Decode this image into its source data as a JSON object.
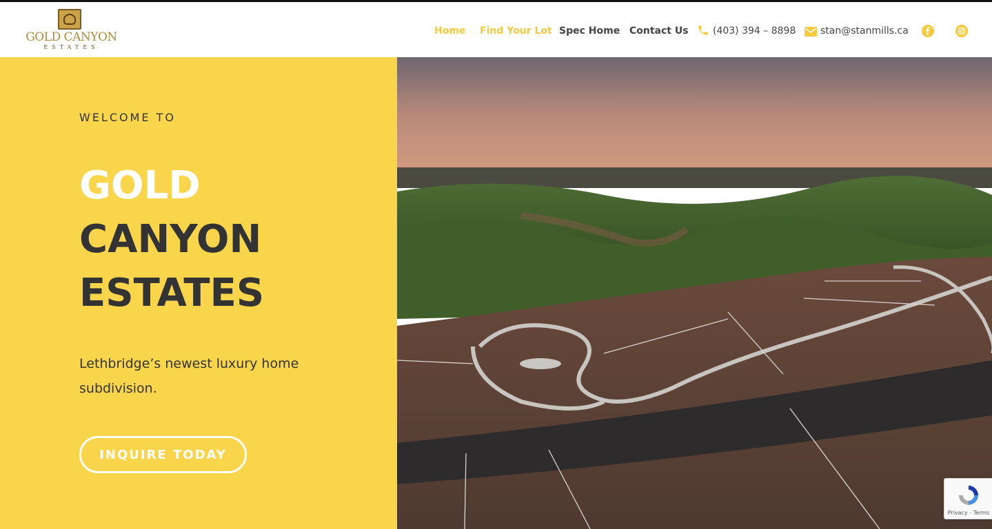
{
  "header": {
    "logo": {
      "title": "GOLD CANYON",
      "subtitle": "ESTATES"
    },
    "nav": [
      {
        "label": "Home",
        "active": true
      },
      {
        "label": "Find Your Lot",
        "active": true
      },
      {
        "label": "Spec Home",
        "active": false
      },
      {
        "label": "Contact Us",
        "active": false
      }
    ],
    "phone": "(403) 394 – 8898",
    "email": "stan@stanmills.ca",
    "icons": {
      "phone": "phone-icon",
      "email": "envelope-icon",
      "facebook": "facebook-icon",
      "instagram": "instagram-icon"
    }
  },
  "hero": {
    "welcome": "WELCOME TO",
    "title_line1": "GOLD",
    "title_line2": "CANYON",
    "title_line3": "ESTATES",
    "tagline": "Lethbridge’s newest luxury home subdivision.",
    "cta": "INQUIRE TODAY"
  },
  "recaptcha": {
    "text": "Privacy - Terms"
  },
  "colors": {
    "accent": "#f9d54b",
    "nav_active": "#f7c93c",
    "text_dark": "#333333"
  }
}
